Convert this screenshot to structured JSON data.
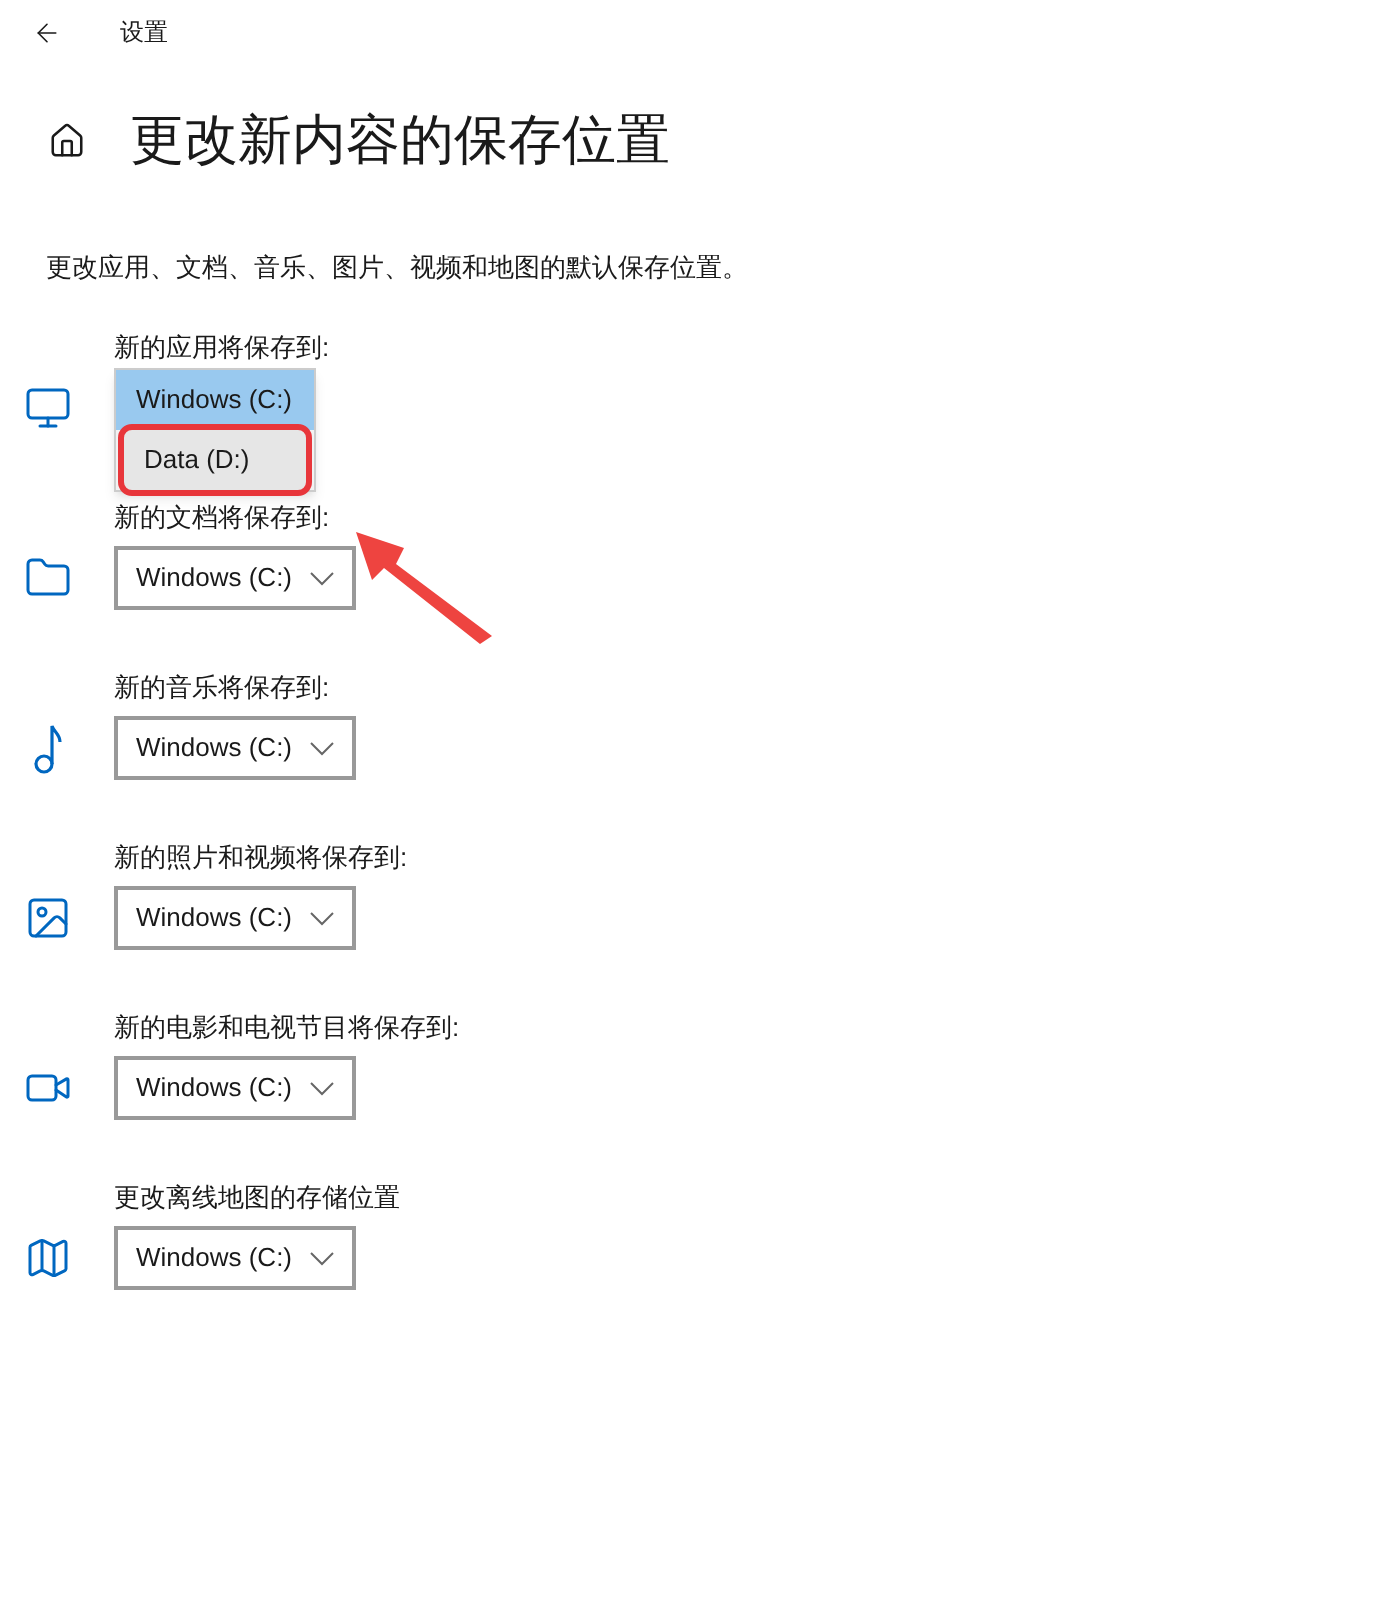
{
  "header": {
    "title": "设置"
  },
  "page": {
    "title": "更改新内容的保存位置",
    "description": "更改应用、文档、音乐、图片、视频和地图的默认保存位置。"
  },
  "sections": [
    {
      "label": "新的应用将保存到:",
      "dropdown": {
        "expanded": true,
        "options": [
          {
            "label": "Windows (C:)",
            "selected": true,
            "marked": false
          },
          {
            "label": "Data (D:)",
            "selected": false,
            "marked": true
          }
        ]
      }
    },
    {
      "label": "新的文档将保存到:",
      "dropdown": {
        "value": "Windows (C:)",
        "expanded": false
      }
    },
    {
      "label": "新的音乐将保存到:",
      "dropdown": {
        "value": "Windows (C:)",
        "expanded": false
      }
    },
    {
      "label": "新的照片和视频将保存到:",
      "dropdown": {
        "value": "Windows (C:)",
        "expanded": false
      }
    },
    {
      "label": "新的电影和电视节目将保存到:",
      "dropdown": {
        "value": "Windows (C:)",
        "expanded": false
      }
    },
    {
      "label": "更改离线地图的存储位置",
      "dropdown": {
        "value": "Windows (C:)",
        "expanded": false
      }
    }
  ]
}
